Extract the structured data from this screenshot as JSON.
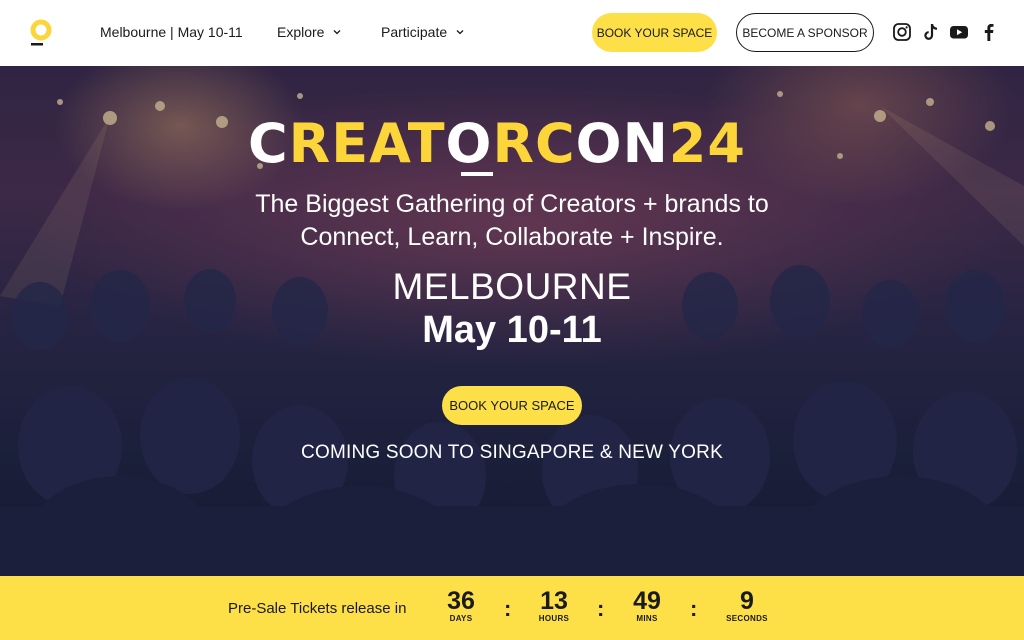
{
  "header": {
    "location": "Melbourne | May 10-11",
    "nav": [
      {
        "label": "Explore"
      },
      {
        "label": "Participate"
      }
    ],
    "book_button": "BOOK YOUR SPACE",
    "sponsor_button": "BECOME A SPONSOR",
    "socials": [
      "instagram-icon",
      "tiktok-icon",
      "youtube-icon",
      "facebook-icon"
    ],
    "accent_color": "#fde047"
  },
  "hero": {
    "brand_white_1": "C",
    "brand_yellow_1": "REAT",
    "brand_white_2": "O",
    "brand_yellow_2": "RC",
    "brand_white_3": "ON",
    "brand_yellow_3": "24",
    "tagline_line1": "The Biggest Gathering of Creators + brands to",
    "tagline_line2": "Connect, Learn, Collaborate + Inspire.",
    "city": "MELBOURNE",
    "dates": "May 10-11",
    "book_button": "BOOK YOUR SPACE",
    "coming_soon": "COMING SOON TO SINGAPORE & NEW YORK"
  },
  "countdown": {
    "label": "Pre-Sale Tickets release in",
    "units": [
      {
        "value": "36",
        "caption": "DAYS"
      },
      {
        "value": "13",
        "caption": "HOURS"
      },
      {
        "value": "49",
        "caption": "MINS"
      },
      {
        "value": "9",
        "caption": "SECONDS"
      }
    ],
    "separator": ":"
  }
}
